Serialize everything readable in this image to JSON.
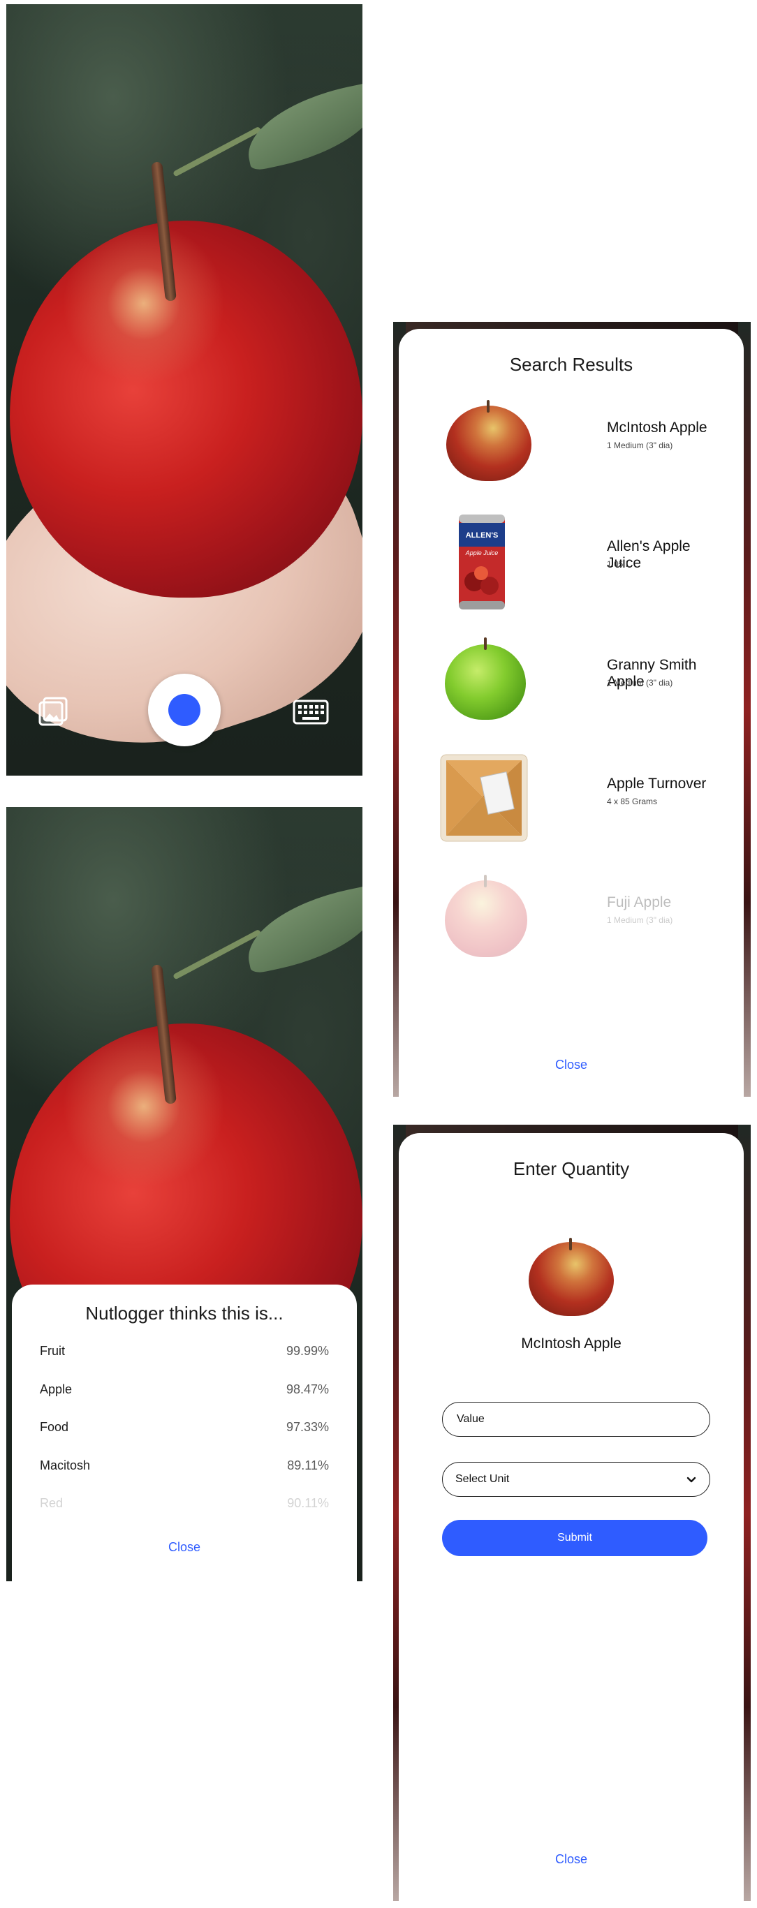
{
  "camera_screen": {
    "gallery_icon": "gallery-icon",
    "capture_icon": "shutter-button",
    "keyboard_icon": "keyboard-icon",
    "accent_color": "#2f5cff"
  },
  "predictions_screen": {
    "title": "Nutlogger thinks this is...",
    "items": [
      {
        "label": "Fruit",
        "confidence": "99.99%"
      },
      {
        "label": "Apple",
        "confidence": "98.47%"
      },
      {
        "label": "Food",
        "confidence": "97.33%"
      },
      {
        "label": "Macitosh",
        "confidence": "89.11%"
      },
      {
        "label": "Red",
        "confidence": "90.11%"
      }
    ],
    "close_label": "Close"
  },
  "search_results_screen": {
    "title": "Search Results",
    "items": [
      {
        "name": "McIntosh Apple",
        "serving": "1 Medium (3\" dia)",
        "image": "mcintosh-apple-image"
      },
      {
        "name": "Allen's Apple Juice",
        "serving": "1.05 L",
        "image": "apple-juice-can-image"
      },
      {
        "name": "Granny Smith Apple",
        "serving": "1 Medium (3\" dia)",
        "image": "green-apple-image"
      },
      {
        "name": "Apple Turnover",
        "serving": "4 x 85 Grams",
        "image": "turnover-pack-image"
      },
      {
        "name": "Fuji Apple",
        "serving": "1 Medium (3\" dia)",
        "image": "fuji-apple-image"
      }
    ],
    "can_brand": "ALLEN'S",
    "can_label": "Apple Juice",
    "close_label": "Close"
  },
  "quantity_screen": {
    "title": "Enter Quantity",
    "item_name": "McIntosh Apple",
    "value_placeholder": "Value",
    "unit_placeholder": "Select Unit",
    "submit_label": "Submit",
    "close_label": "Close"
  },
  "colors": {
    "accent": "#2f5cff",
    "text_primary": "#111111",
    "faded_text": "#d3d3d3"
  }
}
